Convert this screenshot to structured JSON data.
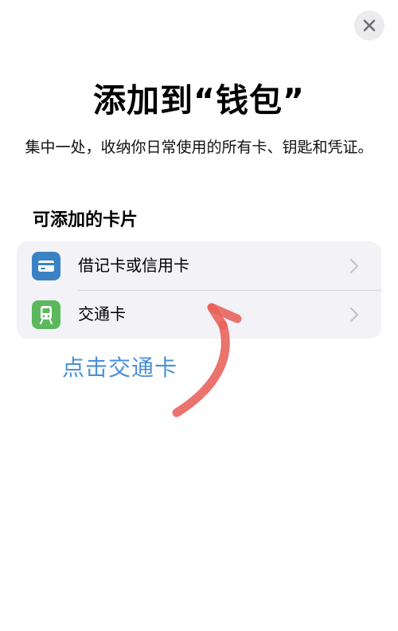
{
  "header": {
    "title": "添加到“钱包”",
    "subtitle": "集中一处，收纳你日常使用的所有卡、钥匙和凭证。"
  },
  "section": {
    "title": "可添加的卡片"
  },
  "cards": [
    {
      "label": "借记卡或信用卡",
      "icon": "credit-card-icon",
      "color": "#3b82c4"
    },
    {
      "label": "交通卡",
      "icon": "train-icon",
      "color": "#5cb85c"
    }
  ],
  "annotation": {
    "text": "点击交通卡",
    "color": "#4a8fd8",
    "arrow_color": "#e8605a"
  }
}
